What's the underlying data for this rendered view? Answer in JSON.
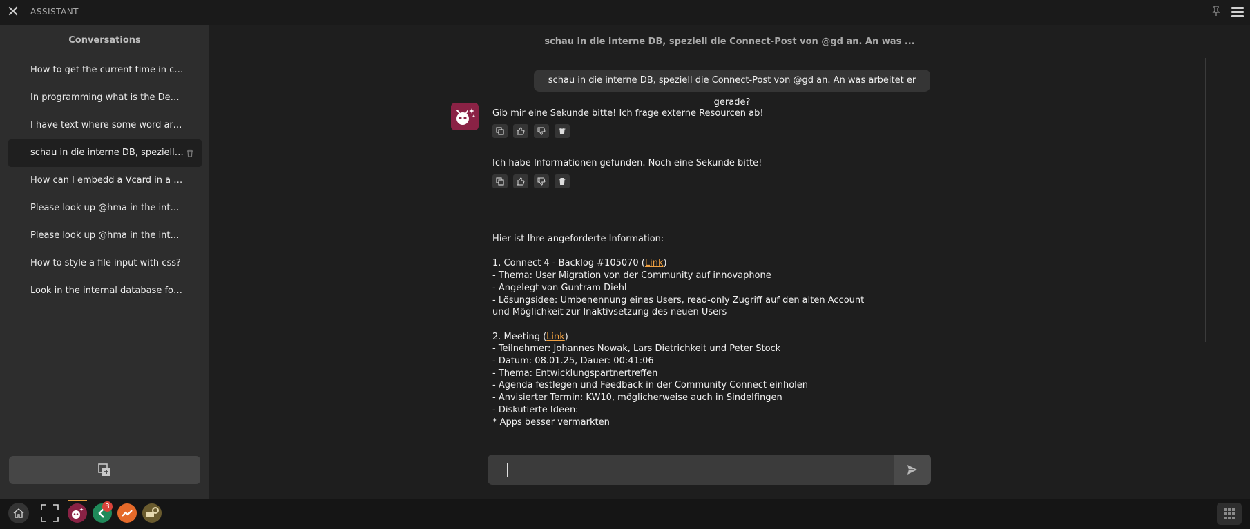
{
  "window": {
    "title": "ASSISTANT"
  },
  "sidebar": {
    "title": "Conversations",
    "items": [
      {
        "label": "How to get the current time in c++?"
      },
      {
        "label": "In programming what is the Dependency Injection?"
      },
      {
        "label": "I have text where some word are enclosed"
      },
      {
        "label": "schau in die interne DB, speziell die Connect-Post von @gd an.",
        "active": true
      },
      {
        "label": "How can I embedd a Vcard in a web page?"
      },
      {
        "label": "Please look up @hma in the internal database"
      },
      {
        "label": "Please look up @hma in the internal database"
      },
      {
        "label": "How to style a file input with css?"
      },
      {
        "label": "Look in the internal database for @ms"
      }
    ]
  },
  "conversation": {
    "header": "schau in die interne DB, speziell die Connect-Post von @gd an. An was ...",
    "user_message": "schau in die interne DB, speziell die Connect-Post von @gd an. An was arbeitet er gerade?",
    "assistant_msg1": "Gib mir eine Sekunde bitte! Ich frage externe Resourcen ab!",
    "assistant_msg2": "Ich habe Informationen gefunden. Noch eine Sekunde bitte!",
    "answer": {
      "intro": "Hier ist Ihre angeforderte Information:",
      "item1_prefix": "1. Connect 4 - Backlog #105070 (",
      "item1_link": "Link",
      "item1_suffix": ")",
      "item1_lines": [
        "- Thema: User Migration von der Community auf innovaphone",
        "- Angelegt von Guntram Diehl",
        "- Lösungsidee: Umbenennung eines Users, read-only Zugriff auf den alten Account und Möglichkeit zur Inaktivsetzung des neuen Users"
      ],
      "item2_prefix": "2. Meeting (",
      "item2_link": "Link",
      "item2_suffix": ")",
      "item2_lines": [
        "- Teilnehmer: Johannes Nowak, Lars Dietrichkeit und Peter Stock",
        "- Datum: 08.01.25, Dauer: 00:41:06",
        "- Thema: Entwicklungspartnertreffen",
        "- Agenda festlegen und Feedback in der Community Connect einholen",
        "- Anvisierter Termin: KW10, möglicherweise auch in Sindelfingen",
        "- Diskutierte Ideen:",
        "* Apps besser vermarkten"
      ]
    }
  },
  "input": {
    "value": "",
    "placeholder": ""
  },
  "taskbar": {
    "badge_count": "3"
  },
  "colors": {
    "accent_link": "#f0a040",
    "bot_avatar": "#8a2245",
    "badge": "#d9433a"
  }
}
